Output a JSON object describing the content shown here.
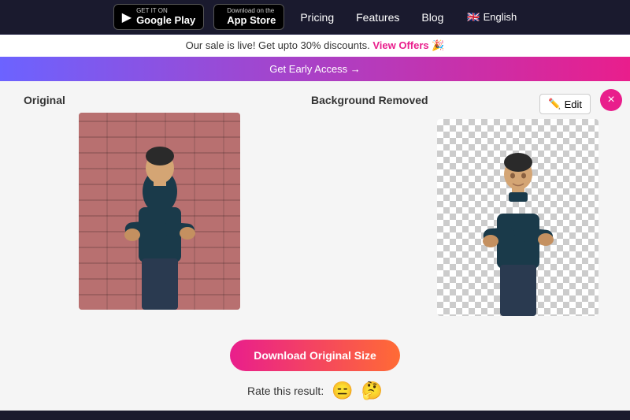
{
  "header": {
    "google_play_small": "GET IT ON",
    "google_play_big": "Google Play",
    "app_store_small": "Download on the",
    "app_store_big": "App Store",
    "nav": {
      "pricing": "Pricing",
      "features": "Features",
      "blog": "Blog",
      "language": "English"
    }
  },
  "sale_banner": {
    "text": "Our sale is live! Get upto 30% discounts.",
    "link_text": "View Offers 🎉"
  },
  "early_access": {
    "label": "Get Early Access →"
  },
  "main": {
    "original_label": "Original",
    "removed_label": "Background Removed",
    "edit_button": "Edit",
    "download_button": "Download Original Size",
    "rating_label": "Rate this result:",
    "emojis": [
      "😑",
      "🤔"
    ],
    "close_icon": "×"
  }
}
